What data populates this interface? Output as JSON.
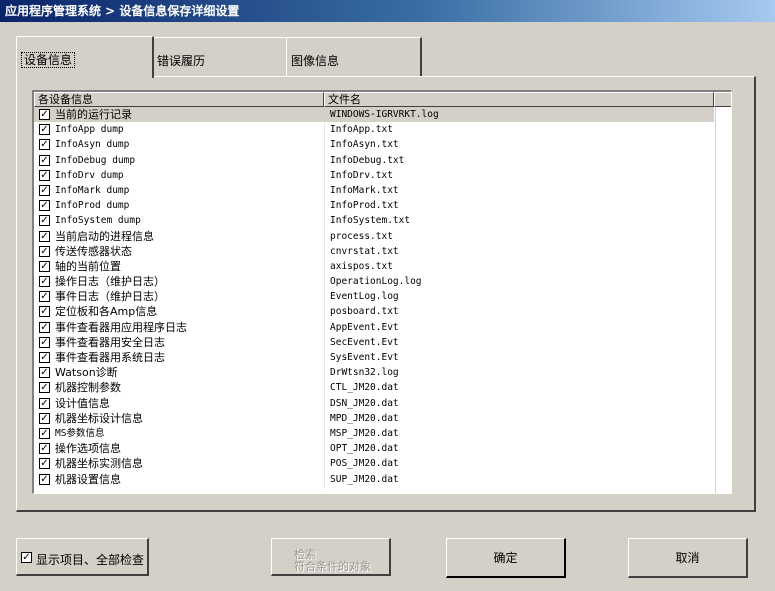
{
  "window": {
    "title": "应用程序管理系统 > 设备信息保存详细设置"
  },
  "tabs": [
    {
      "label": "设备信息"
    },
    {
      "label": "错误履历"
    },
    {
      "label": "图像信息"
    }
  ],
  "list": {
    "columns": [
      "各设备信息",
      "文件名"
    ],
    "rows": [
      {
        "name": "当前的运行记录",
        "file": "WINDOWS-IGRVRKT.log"
      },
      {
        "name": "InfoApp dump",
        "file": "InfoApp.txt"
      },
      {
        "name": "InfoAsyn dump",
        "file": "InfoAsyn.txt"
      },
      {
        "name": "InfoDebug dump",
        "file": "InfoDebug.txt"
      },
      {
        "name": "InfoDrv dump",
        "file": "InfoDrv.txt"
      },
      {
        "name": "InfoMark dump",
        "file": "InfoMark.txt"
      },
      {
        "name": "InfoProd dump",
        "file": "InfoProd.txt"
      },
      {
        "name": "InfoSystem dump",
        "file": "InfoSystem.txt"
      },
      {
        "name": "当前启动的进程信息",
        "file": "process.txt"
      },
      {
        "name": "传送传感器状态",
        "file": "cnvrstat.txt"
      },
      {
        "name": "轴的当前位置",
        "file": "axispos.txt"
      },
      {
        "name": "操作日志（维护日志）",
        "file": "OperationLog.log"
      },
      {
        "name": "事件日志（维护日志）",
        "file": "EventLog.log"
      },
      {
        "name": "定位板和各Amp信息",
        "file": "posboard.txt"
      },
      {
        "name": "事件查看器用应用程序日志",
        "file": "AppEvent.Evt"
      },
      {
        "name": "事件查看器用安全日志",
        "file": "SecEvent.Evt"
      },
      {
        "name": "事件查看器用系统日志",
        "file": "SysEvent.Evt"
      },
      {
        "name": " Watson诊断",
        "file": "DrWtsn32.log"
      },
      {
        "name": "机器控制参数",
        "file": "CTL_JM20.dat"
      },
      {
        "name": "设计值信息",
        "file": "DSN_JM20.dat"
      },
      {
        "name": "机器坐标设计信息",
        "file": "MPD_JM20.dat"
      },
      {
        "name": "MS参数信息",
        "file": "MSP_JM20.dat"
      },
      {
        "name": "操作选项信息",
        "file": "OPT_JM20.dat"
      },
      {
        "name": "机器坐标实测信息",
        "file": "POS_JM20.dat"
      },
      {
        "name": "机器设置信息",
        "file": "SUP_JM20.dat"
      }
    ],
    "checked_mark": "✓"
  },
  "footer": {
    "show_all_label": "显示项目、全部检查",
    "select_label_line1": "检索",
    "select_label_line2": "符合条件的对象",
    "ok_label": "确定",
    "cancel_label": "取消"
  }
}
